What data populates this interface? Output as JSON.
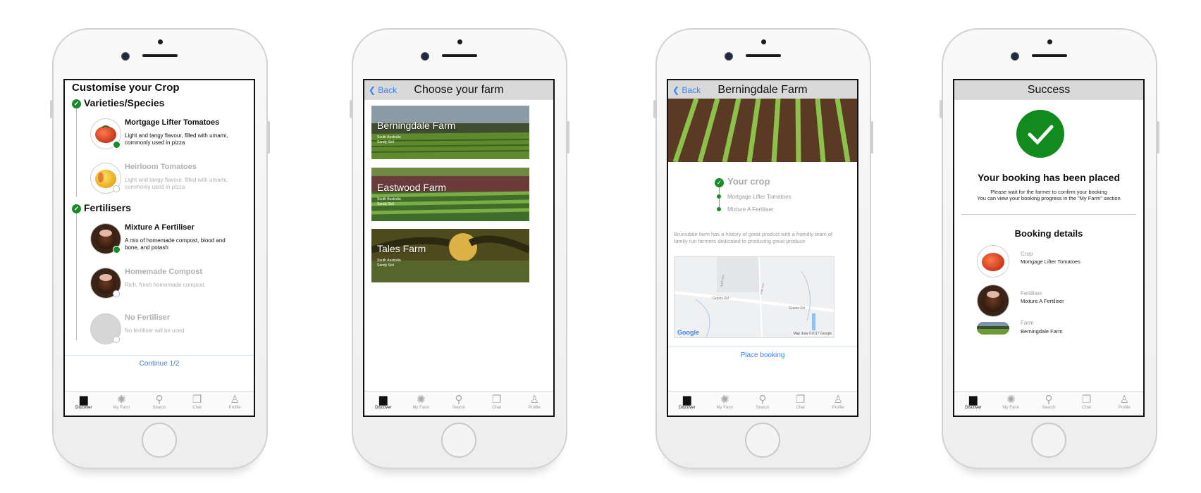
{
  "tabs": [
    {
      "label": "Discover",
      "icon": "book-icon"
    },
    {
      "label": "My Farm",
      "icon": "sun-icon"
    },
    {
      "label": "Search",
      "icon": "search-icon"
    },
    {
      "label": "Chat",
      "icon": "chat-icon"
    },
    {
      "label": "Profile",
      "icon": "person-icon"
    }
  ],
  "screen1": {
    "title": "Customise your Crop",
    "section1": "Varieties/Species",
    "section2": "Fertilisers",
    "items": [
      {
        "title": "Mortgage Lifter Tomatoes",
        "desc": "Light and tangy flavour, filled with umami, commonly used in pizza"
      },
      {
        "title": "Heirloom Tomatoes",
        "desc": "Light and tangy flavour, filled with umami, commonly used in pizza"
      },
      {
        "title": "Mixture A Fertiliser",
        "desc": "A mix of homemade compost, blood and bone, and potash"
      },
      {
        "title": "Homemade Compost",
        "desc": "Rich, fresh homemade compost"
      },
      {
        "title": "No Fertiliser",
        "desc": "No fertiliser will be used"
      }
    ],
    "continue": "Continue 1/2"
  },
  "screen2": {
    "back": "Back",
    "title": "Choose your farm",
    "farms": [
      {
        "name": "Berningdale Farm",
        "region": "South Australia",
        "soil": "Sandy Soil"
      },
      {
        "name": "Eastwood Farm",
        "region": "South Australia",
        "soil": "Sandy Soil"
      },
      {
        "name": "Tales Farm",
        "region": "South Australia",
        "soil": "Sandy Soil"
      }
    ]
  },
  "screen3": {
    "back": "Back",
    "title": "Berningdale Farm",
    "crop_heading": "Your crop",
    "crop_items": [
      "Mortgage Lifter Tomatoes",
      "Mixture A Fertiliser"
    ],
    "description": "Brunsdale farm has a history of great product with a friendly team of family run farmers dedicated to producing great produce",
    "map": {
      "brand": "Google",
      "credit": "Map data ©2017 Google",
      "road": "Grants Rd",
      "road2": "Grants Rd",
      "streets": [
        "North Ave",
        "Fifth Ave"
      ]
    },
    "place": "Place booking"
  },
  "screen4": {
    "title": "Success",
    "headline": "Your booking has been placed",
    "wait1": "Please wait for the farmer to confirm your booking",
    "wait2": "You can view your booking progress in the \"My Farm\" section",
    "details_title": "Booking details",
    "details": [
      {
        "label": "Crop",
        "value": "Mortgage Lifter Tomatoes"
      },
      {
        "label": "Fertiliser",
        "value": "Mixture A Fertiliser"
      },
      {
        "label": "Farm",
        "value": "Berningdale Farm"
      }
    ]
  },
  "colors": {
    "accent_green": "#198a2a",
    "link_blue": "#3b82f6",
    "navbar_grey": "#d9d9d9"
  }
}
